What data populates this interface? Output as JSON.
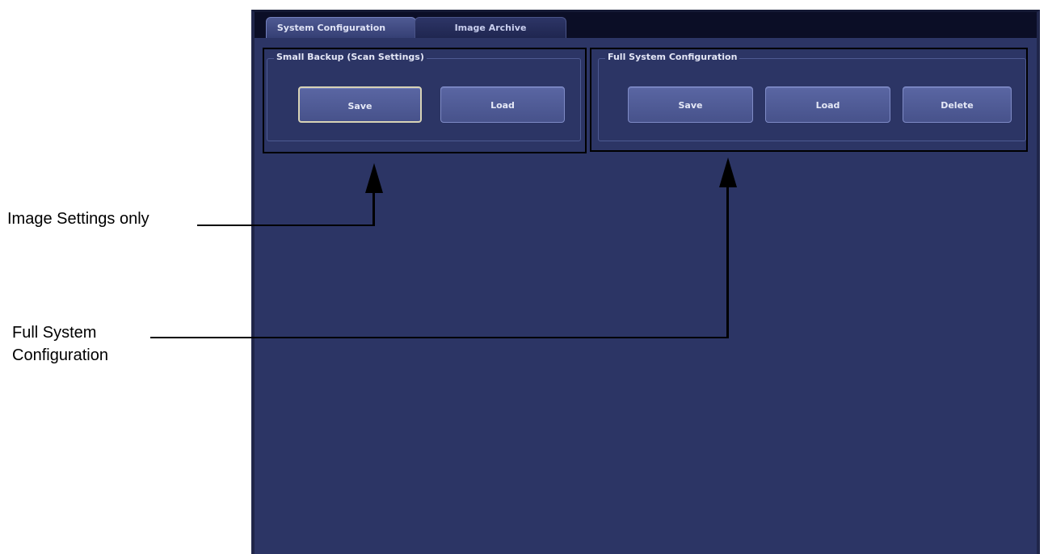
{
  "tabs": [
    {
      "label": "System Configuration",
      "active": true
    },
    {
      "label": "Image Archive",
      "active": false
    }
  ],
  "small_backup": {
    "title": "Small Backup (Scan Settings)",
    "save_label": "Save",
    "load_label": "Load"
  },
  "full_config": {
    "title": "Full System Configuration",
    "save_label": "Save",
    "load_label": "Load",
    "delete_label": "Delete"
  },
  "annotations": {
    "image_settings": "Image Settings only",
    "full_config_line1": "Full System",
    "full_config_line2": "Configuration"
  },
  "colors": {
    "panel_background": "#2c3565",
    "tabbar_background": "#0b0e26",
    "button_face": "#4f5a96",
    "focus_border": "#d8d3b6"
  }
}
